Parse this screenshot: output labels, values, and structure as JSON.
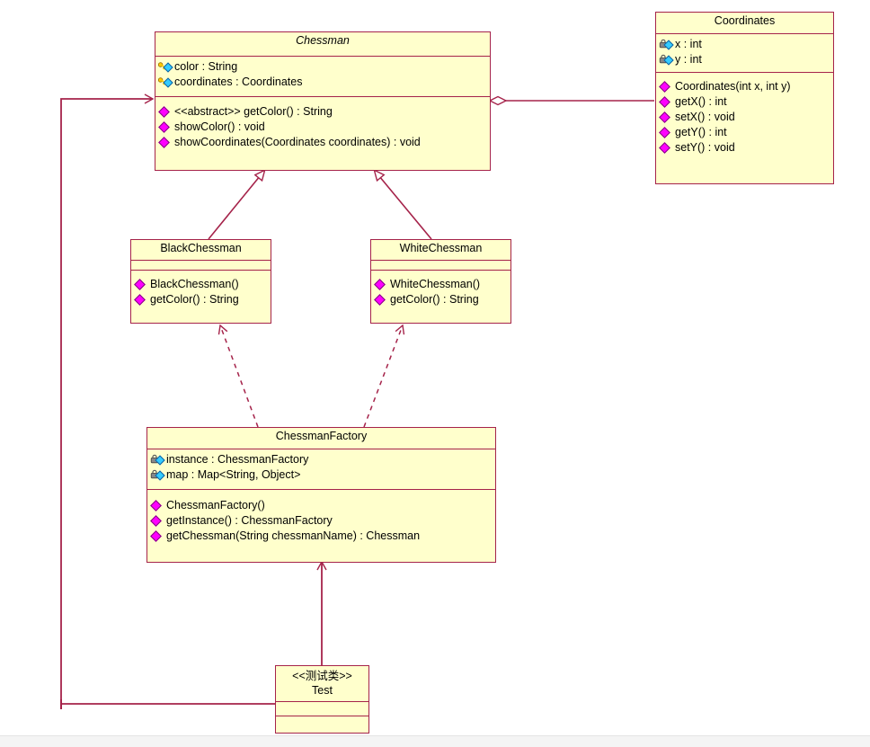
{
  "diagram": {
    "title": "Chessman Flyweight UML Class Diagram",
    "colors": {
      "class_fill": "#ffffcc",
      "class_border": "#a5234a",
      "edge": "#a5234a",
      "public_method_icon": "#ff00ff",
      "field_icon": "#33ccff",
      "protected_key_icon": "#ffcc00",
      "private_lock_icon": "#808080"
    },
    "classes": [
      {
        "id": "chessman",
        "name": "Chessman",
        "stereotype": "",
        "abstract": true,
        "attributes": [
          {
            "icon": "protected-key-icon",
            "text": "color : String"
          },
          {
            "icon": "protected-key-icon",
            "text": "coordinates : Coordinates"
          }
        ],
        "operations": [
          {
            "icon": "public-method-icon",
            "text": "<<abstract>> getColor() : String"
          },
          {
            "icon": "public-method-icon",
            "text": "showColor() : void"
          },
          {
            "icon": "public-method-icon",
            "text": "showCoordinates(Coordinates coordinates) : void"
          }
        ]
      },
      {
        "id": "coordinates",
        "name": "Coordinates",
        "stereotype": "",
        "abstract": false,
        "attributes": [
          {
            "icon": "private-lock-icon",
            "text": "x : int"
          },
          {
            "icon": "private-lock-icon",
            "text": "y : int"
          }
        ],
        "operations": [
          {
            "icon": "public-method-icon",
            "text": "Coordinates(int x, int y)"
          },
          {
            "icon": "public-method-icon",
            "text": "getX() : int"
          },
          {
            "icon": "public-method-icon",
            "text": "setX() : void"
          },
          {
            "icon": "public-method-icon",
            "text": "getY() : int"
          },
          {
            "icon": "public-method-icon",
            "text": "setY() : void"
          }
        ]
      },
      {
        "id": "blackchessman",
        "name": "BlackChessman",
        "stereotype": "",
        "abstract": false,
        "attributes": [],
        "operations": [
          {
            "icon": "public-method-icon",
            "text": "BlackChessman()"
          },
          {
            "icon": "public-method-icon",
            "text": "getColor() : String"
          }
        ]
      },
      {
        "id": "whitechessman",
        "name": "WhiteChessman",
        "stereotype": "",
        "abstract": false,
        "attributes": [],
        "operations": [
          {
            "icon": "public-method-icon",
            "text": "WhiteChessman()"
          },
          {
            "icon": "public-method-icon",
            "text": "getColor() : String"
          }
        ]
      },
      {
        "id": "chessmanfactory",
        "name": "ChessmanFactory",
        "stereotype": "",
        "abstract": false,
        "attributes": [
          {
            "icon": "private-lock-icon",
            "text": "instance : ChessmanFactory"
          },
          {
            "icon": "private-lock-icon",
            "text": "map : Map<String, Object>"
          }
        ],
        "operations": [
          {
            "icon": "public-method-icon",
            "text": "ChessmanFactory()"
          },
          {
            "icon": "public-method-icon",
            "text": "getInstance() : ChessmanFactory"
          },
          {
            "icon": "public-method-icon",
            "text": "getChessman(String chessmanName) : Chessman"
          }
        ]
      },
      {
        "id": "test",
        "name": "Test",
        "stereotype": "<<测试类>>",
        "abstract": false,
        "attributes": [],
        "operations": []
      }
    ],
    "relationships": [
      {
        "id": "rel-aggregation-chessman-coordinates",
        "type": "aggregation",
        "from": "chessman",
        "to": "coordinates"
      },
      {
        "id": "rel-generalization-black-chessman",
        "type": "generalization",
        "from": "blackchessman",
        "to": "chessman"
      },
      {
        "id": "rel-generalization-white-chessman",
        "type": "generalization",
        "from": "whitechessman",
        "to": "chessman"
      },
      {
        "id": "rel-dependency-factory-black",
        "type": "dependency",
        "from": "chessmanfactory",
        "to": "blackchessman"
      },
      {
        "id": "rel-dependency-factory-white",
        "type": "dependency",
        "from": "chessmanfactory",
        "to": "whitechessman"
      },
      {
        "id": "rel-association-test-factory",
        "type": "association",
        "from": "test",
        "to": "chessmanfactory"
      },
      {
        "id": "rel-association-test-chessman",
        "type": "association",
        "from": "test",
        "to": "chessman"
      }
    ]
  }
}
